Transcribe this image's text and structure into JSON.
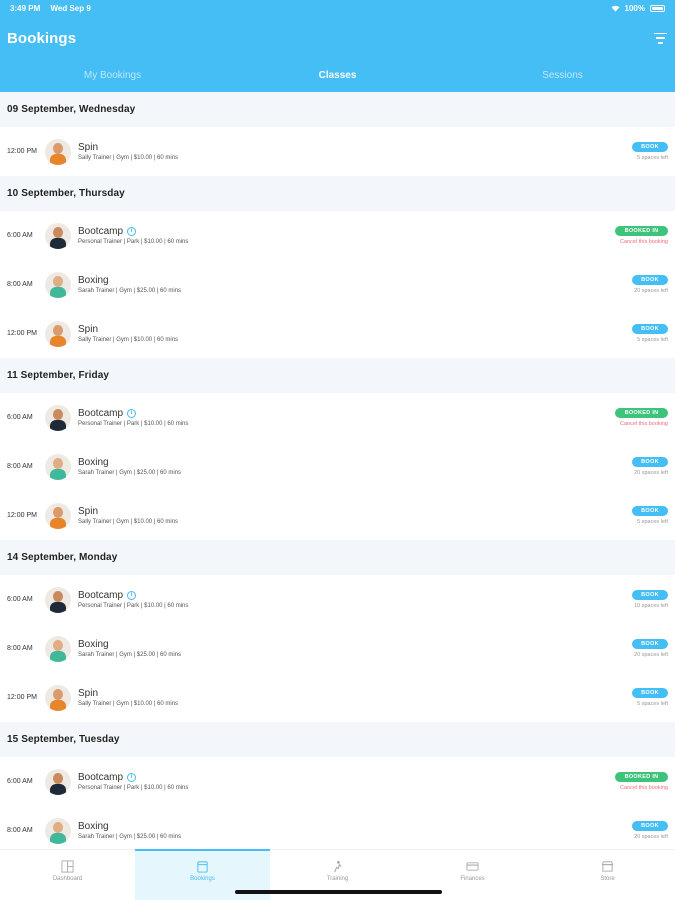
{
  "status": {
    "time": "3:49 PM",
    "date": "Wed Sep 9",
    "battery": "100%"
  },
  "header": {
    "title": "Bookings"
  },
  "tabs": [
    {
      "label": "My Bookings",
      "active": false
    },
    {
      "label": "Classes",
      "active": true
    },
    {
      "label": "Sessions",
      "active": false
    }
  ],
  "days": [
    {
      "label": "09 September, Wednesday",
      "rows": [
        {
          "time": "12:00 PM",
          "name": "Spin",
          "meta": "Sally Trainer | Gym | $10.00 | 60 mins",
          "trainer": "sally",
          "status": "book",
          "badge": "BOOK",
          "sub": "5 spaces left",
          "info": false
        }
      ]
    },
    {
      "label": "10 September, Thursday",
      "rows": [
        {
          "time": "6:00 AM",
          "name": "Bootcamp",
          "meta": "Personal Trainer | Park | $10.00 | 60 mins",
          "trainer": "personal",
          "status": "booked",
          "badge": "BOOKED IN",
          "sub": "Cancel this booking",
          "info": true
        },
        {
          "time": "8:00 AM",
          "name": "Boxing",
          "meta": "Sarah Trainer | Gym | $25.00 | 60 mins",
          "trainer": "sarah",
          "status": "book",
          "badge": "BOOK",
          "sub": "20 spaces left",
          "info": false
        },
        {
          "time": "12:00 PM",
          "name": "Spin",
          "meta": "Sally Trainer | Gym | $10.00 | 60 mins",
          "trainer": "sally",
          "status": "book",
          "badge": "BOOK",
          "sub": "5 spaces left",
          "info": false
        }
      ]
    },
    {
      "label": "11 September, Friday",
      "rows": [
        {
          "time": "6:00 AM",
          "name": "Bootcamp",
          "meta": "Personal Trainer | Park | $10.00 | 60 mins",
          "trainer": "personal",
          "status": "booked",
          "badge": "BOOKED IN",
          "sub": "Cancel this booking",
          "info": true
        },
        {
          "time": "8:00 AM",
          "name": "Boxing",
          "meta": "Sarah Trainer | Gym | $25.00 | 60 mins",
          "trainer": "sarah",
          "status": "book",
          "badge": "BOOK",
          "sub": "20 spaces left",
          "info": false
        },
        {
          "time": "12:00 PM",
          "name": "Spin",
          "meta": "Sally Trainer | Gym | $10.00 | 60 mins",
          "trainer": "sally",
          "status": "book",
          "badge": "BOOK",
          "sub": "5 spaces left",
          "info": false
        }
      ]
    },
    {
      "label": "14 September, Monday",
      "rows": [
        {
          "time": "6:00 AM",
          "name": "Bootcamp",
          "meta": "Personal Trainer | Park | $10.00 | 60 mins",
          "trainer": "personal",
          "status": "book",
          "badge": "BOOK",
          "sub": "10 spaces left",
          "info": true
        },
        {
          "time": "8:00 AM",
          "name": "Boxing",
          "meta": "Sarah Trainer | Gym | $25.00 | 60 mins",
          "trainer": "sarah",
          "status": "book",
          "badge": "BOOK",
          "sub": "20 spaces left",
          "info": false
        },
        {
          "time": "12:00 PM",
          "name": "Spin",
          "meta": "Sally Trainer | Gym | $10.00 | 60 mins",
          "trainer": "sally",
          "status": "book",
          "badge": "BOOK",
          "sub": "5 spaces left",
          "info": false
        }
      ]
    },
    {
      "label": "15 September, Tuesday",
      "rows": [
        {
          "time": "6:00 AM",
          "name": "Bootcamp",
          "meta": "Personal Trainer | Park | $10.00 | 60 mins",
          "trainer": "personal",
          "status": "booked",
          "badge": "BOOKED IN",
          "sub": "Cancel this booking",
          "info": true
        },
        {
          "time": "8:00 AM",
          "name": "Boxing",
          "meta": "Sarah Trainer | Gym | $25.00 | 60 mins",
          "trainer": "sarah",
          "status": "book",
          "badge": "BOOK",
          "sub": "20 spaces left",
          "info": false
        }
      ]
    }
  ],
  "tabbar": [
    {
      "label": "Dashboard",
      "icon": "dashboard-icon",
      "active": false
    },
    {
      "label": "Bookings",
      "icon": "calendar-icon",
      "active": true
    },
    {
      "label": "Training",
      "icon": "training-icon",
      "active": false
    },
    {
      "label": "Finances",
      "icon": "card-icon",
      "active": false
    },
    {
      "label": "Store",
      "icon": "store-icon",
      "active": false
    }
  ],
  "colors": {
    "primary": "#45bdf5",
    "booked": "#3ec37a",
    "cancel": "#f06c7e",
    "day_bg": "#f3f7fb"
  }
}
